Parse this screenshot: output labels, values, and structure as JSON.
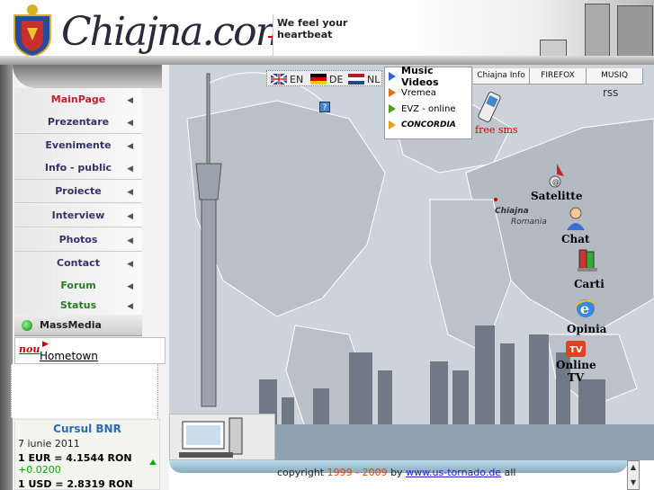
{
  "header": {
    "logo_text": "Chiajna.com",
    "tagline": "We feel your heartbeat"
  },
  "sidebar": {
    "items": [
      {
        "label": "MainPage",
        "style": "red"
      },
      {
        "label": "Prezentare",
        "style": ""
      },
      {
        "label": "Evenimente",
        "style": ""
      },
      {
        "label": "Info - public",
        "style": ""
      },
      {
        "label": "Proiecte",
        "style": ""
      },
      {
        "label": "Interview",
        "style": ""
      },
      {
        "label": "Photos",
        "style": ""
      },
      {
        "label": "Contact",
        "style": ""
      },
      {
        "label": "Forum",
        "style": "green"
      },
      {
        "label": "Status",
        "style": "green"
      }
    ],
    "massmedia_label": "MassMedia",
    "hometown_badge": "nou",
    "hometown_label": "Hometown"
  },
  "bnr": {
    "title": "Cursul BNR",
    "date": "7 iunie 2011",
    "eur_rate": "1 EUR = 4.1544 RON",
    "eur_change": "+0.0200",
    "usd_rate": "1 USD = 2.8319 RON"
  },
  "languages": [
    {
      "code": "EN"
    },
    {
      "code": "DE"
    },
    {
      "code": "NL"
    }
  ],
  "help_icon": "?",
  "media_menu": {
    "items": [
      {
        "label": "Music Videos",
        "color": "#3366cc"
      },
      {
        "label": "Vremea",
        "color": "#e07020"
      },
      {
        "label": "EVZ - online",
        "color": "#4aa020"
      },
      {
        "label": "CONCORDIA",
        "color": "#e0a020"
      }
    ]
  },
  "tabs": [
    "Chiajna Info",
    "FIREFOX",
    "MUSIQ"
  ],
  "rss_label": "rss",
  "free_sms_label": "free sms",
  "map_labels": {
    "chiajna": "Chiajna",
    "romania": "Romania"
  },
  "right_links": [
    {
      "label": "Satelitte"
    },
    {
      "label": "Chat"
    },
    {
      "label": "Carti"
    },
    {
      "label": "Opinia"
    },
    {
      "label": "Online TV"
    }
  ],
  "footer": {
    "prefix": "copyright ",
    "years": "1999 - 2009",
    "by": " by ",
    "link": "www.us-tornado.de",
    "suffix": " all"
  },
  "colors": {
    "nav_text": "#333366",
    "accent_red": "#bb2233",
    "link_blue": "#2222cc"
  }
}
